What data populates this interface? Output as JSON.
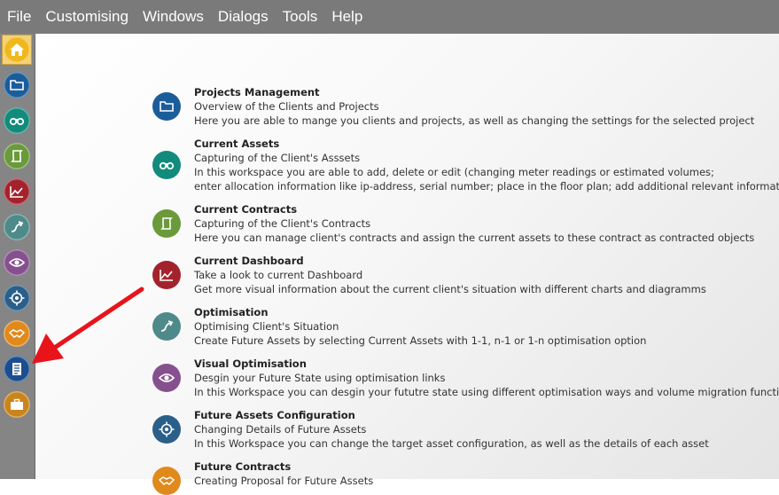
{
  "menubar": {
    "items": [
      "File",
      "Customising",
      "Windows",
      "Dialogs",
      "Tools",
      "Help"
    ]
  },
  "sidebar": {
    "items": [
      {
        "icon": "home-icon",
        "color": "#f0b81c",
        "active": true
      },
      {
        "icon": "folder-icon",
        "color": "#1b5d9a"
      },
      {
        "icon": "binoculars-icon",
        "color": "#128b7c"
      },
      {
        "icon": "scroll-icon",
        "color": "#6a9a3a"
      },
      {
        "icon": "line-chart-icon",
        "color": "#a3232d"
      },
      {
        "icon": "trend-arrow-icon",
        "color": "#4e8a8a"
      },
      {
        "icon": "eye-icon",
        "color": "#86508f"
      },
      {
        "icon": "target-icon",
        "color": "#2a5f8a"
      },
      {
        "icon": "handshake-icon",
        "color": "#e08a1c"
      },
      {
        "icon": "document-list-icon",
        "color": "#1b4e8f"
      },
      {
        "icon": "briefcase-icon",
        "color": "#c9841b"
      }
    ]
  },
  "entries": [
    {
      "icon": "folder-icon",
      "color": "#1b5d9a",
      "title": "Projects Management",
      "subtitle": "Overview of the Clients and Projects",
      "lines": [
        "Here you are able to mange you clients and projects, as well as changing the settings for the selected project"
      ]
    },
    {
      "icon": "binoculars-icon",
      "color": "#128b7c",
      "title": "Current Assets",
      "subtitle": "Capturing of the Client's Asssets",
      "lines": [
        "In this workspace you are able to add, delete or edit (changing meter readings or estimated volumes;",
        "enter allocation information like ip-address, serial number; place in the floor plan; add additional relevant information)"
      ]
    },
    {
      "icon": "scroll-icon",
      "color": "#6a9a3a",
      "title": "Current Contracts",
      "subtitle": "Capturing of the Client's Contracts",
      "lines": [
        "Here you can manage client's contracts and assign the current assets to these contract as contracted objects"
      ]
    },
    {
      "icon": "line-chart-icon",
      "color": "#a3232d",
      "title": "Current Dashboard",
      "subtitle": "Take a look to current Dashboard",
      "lines": [
        "Get more visual information about the current client's situation with different charts and diagramms"
      ]
    },
    {
      "icon": "trend-arrow-icon",
      "color": "#4e8a8a",
      "title": "Optimisation",
      "subtitle": "Optimising Client's Situation",
      "lines": [
        "Create Future Assets by selecting Current Assets with 1-1, n-1 or 1-n optimisation option"
      ]
    },
    {
      "icon": "eye-icon",
      "color": "#86508f",
      "title": "Visual Optimisation",
      "subtitle": "Desgin your Future State using optimisation links",
      "lines": [
        "In this Workspace you can desgin your fututre state using different optimisation ways and volume migration functionali"
      ]
    },
    {
      "icon": "target-icon",
      "color": "#2a5f8a",
      "title": "Future Assets Configuration",
      "subtitle": "Changing Details of Future Assets",
      "lines": [
        "In this Workspace you can change the target asset configuration, as well as the details of each asset"
      ]
    },
    {
      "icon": "handshake-icon",
      "color": "#e08a1c",
      "title": "Future Contracts",
      "subtitle": "Creating Proposal for Future Assets",
      "lines": []
    }
  ],
  "annotation": {
    "color": "#e8141a"
  }
}
